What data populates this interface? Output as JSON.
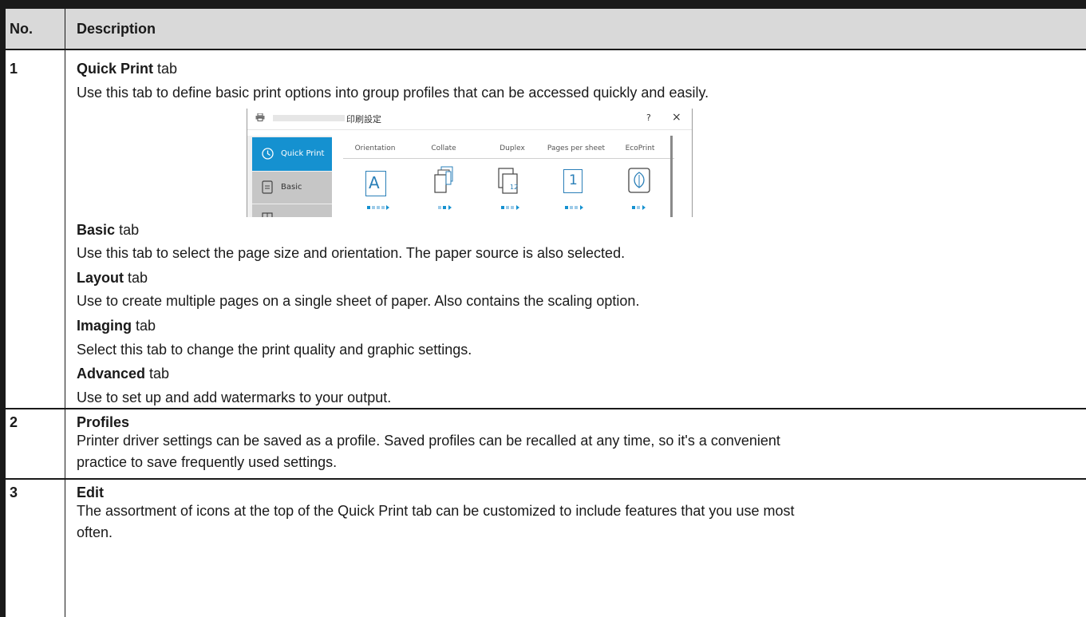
{
  "header": {
    "no": "No.",
    "description": "Description"
  },
  "row1": {
    "no": "1",
    "quick_print_title": "Quick Print",
    "tab_suffix": "tab",
    "quick_print_desc": "Use this tab to define basic print options into group profiles that can be accessed quickly and easily.",
    "basic_title": "Basic",
    "basic_desc": "Use this tab to select the page size and orientation. The paper source is also selected.",
    "layout_title": "Layout",
    "layout_desc": "Use to create multiple pages on a single sheet of paper. Also contains the scaling option.",
    "imaging_title": "Imaging",
    "imaging_desc": "Select this tab to change the print quality and graphic settings.",
    "advanced_title": "Advanced",
    "advanced_desc": "Use to set up and add watermarks to your output."
  },
  "row2": {
    "no": "2",
    "title": "Profiles",
    "desc_line1": "Printer driver settings can be saved as a profile. Saved profiles can be recalled at any time, so it's a convenient",
    "desc_line2": "practice to save frequently used settings."
  },
  "row3": {
    "no": "3",
    "title": "Edit",
    "desc_line1": "The assortment of icons at the top of the Quick Print tab can be customized to include features that you use most",
    "desc_line2": "often."
  },
  "screenshot": {
    "window_title": "印刷設定",
    "help": "?",
    "close": "×",
    "nav": [
      "Quick Print",
      "Basic"
    ],
    "columns": [
      "Orientation",
      "Collate",
      "Duplex",
      "Pages per sheet",
      "EcoPrint"
    ],
    "orientation_icon_letter": "A",
    "pages_per_sheet_value": "1",
    "accent_color": "#1591d0"
  }
}
